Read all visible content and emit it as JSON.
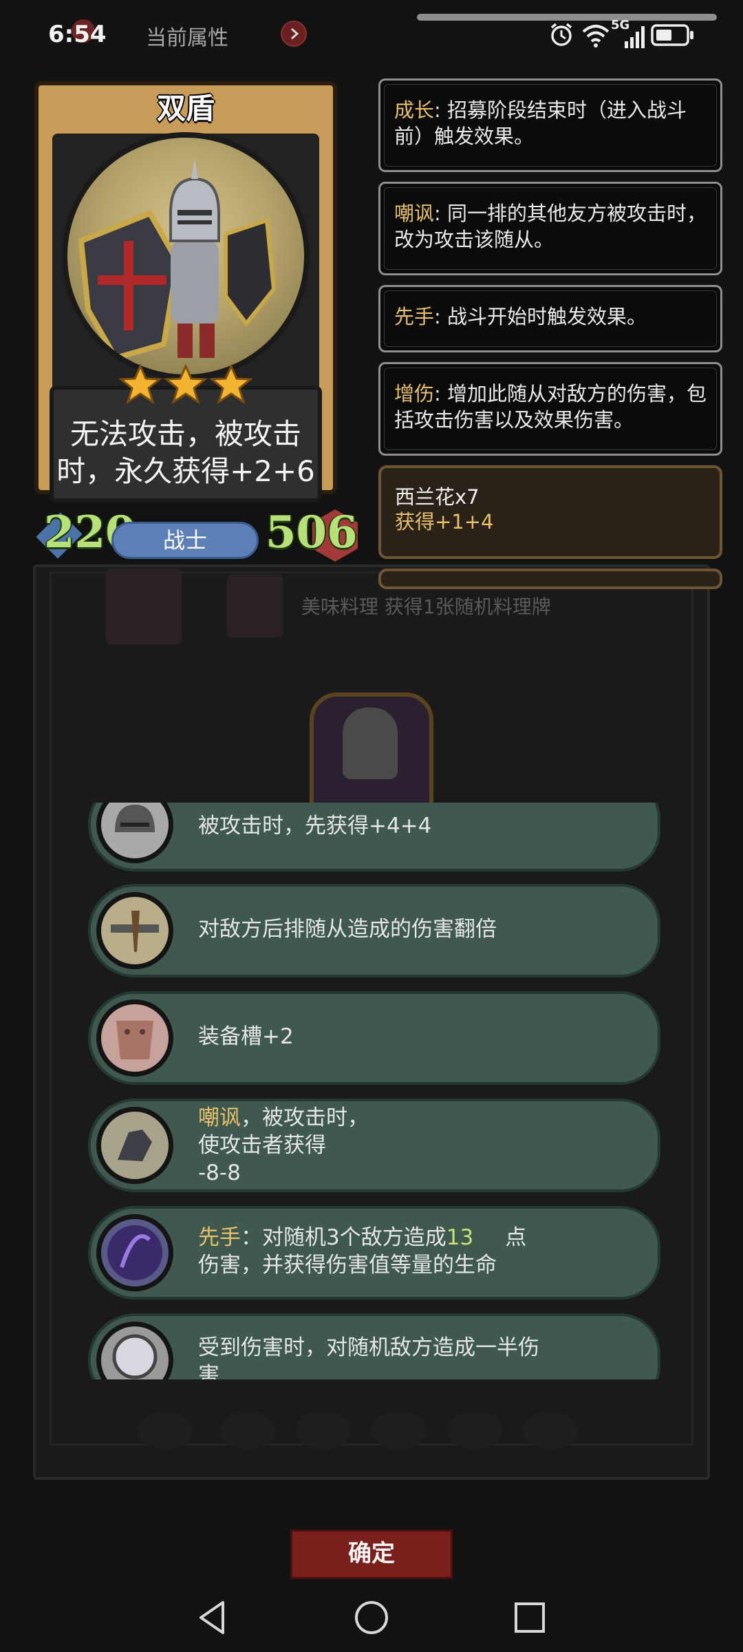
{
  "status_bar": {
    "time": "6:54",
    "page_label": "当前属性",
    "network": "5G"
  },
  "card": {
    "name": "双盾",
    "stars": 3,
    "description": "无法攻击，被攻击时，永久获得+2+6",
    "attack": "220",
    "health": "506",
    "class": "战士"
  },
  "keywords": [
    {
      "name": "成长",
      "text": ": 招募阶段结束时（进入战斗前）触发效果。"
    },
    {
      "name": "嘲讽",
      "text": ": 同一排的其他友方被攻击时，改为攻击该随从。"
    },
    {
      "name": "先手",
      "text": ": 战斗开始时触发效果。"
    },
    {
      "name": "增伤",
      "text": ": 增加此随从对敌方的伤害，包括攻击伤害以及效果伤害。"
    }
  ],
  "item": {
    "name": "西兰花x7",
    "effect": "获得+1+4"
  },
  "background": {
    "line": "美味料理 获得1张随机料理牌"
  },
  "skills": [
    {
      "text": "被攻击时，先获得+4+4"
    },
    {
      "text": "对敌方后排随从造成的伤害翻倍"
    },
    {
      "text": "装备槽+2"
    },
    {
      "keyword": "嘲讽",
      "text1": "，被攻击时，",
      "line2": "使攻击者获得",
      "line3": "-8-8"
    },
    {
      "keyword": "先手",
      "text1": "：对随机3个敌方造成",
      "number": "13",
      "text2": "点",
      "line2": "伤害，并获得伤害值等量的生命"
    },
    {
      "text": "受到伤害时，对随机敌方造成一半伤",
      "line2": "害"
    }
  ],
  "confirm_label": "确定",
  "colors": {
    "keyword": "#e8c06b",
    "skill_bg": "#3f594e",
    "confirm": "#7a1f1c",
    "stat": "#b8e07a"
  }
}
